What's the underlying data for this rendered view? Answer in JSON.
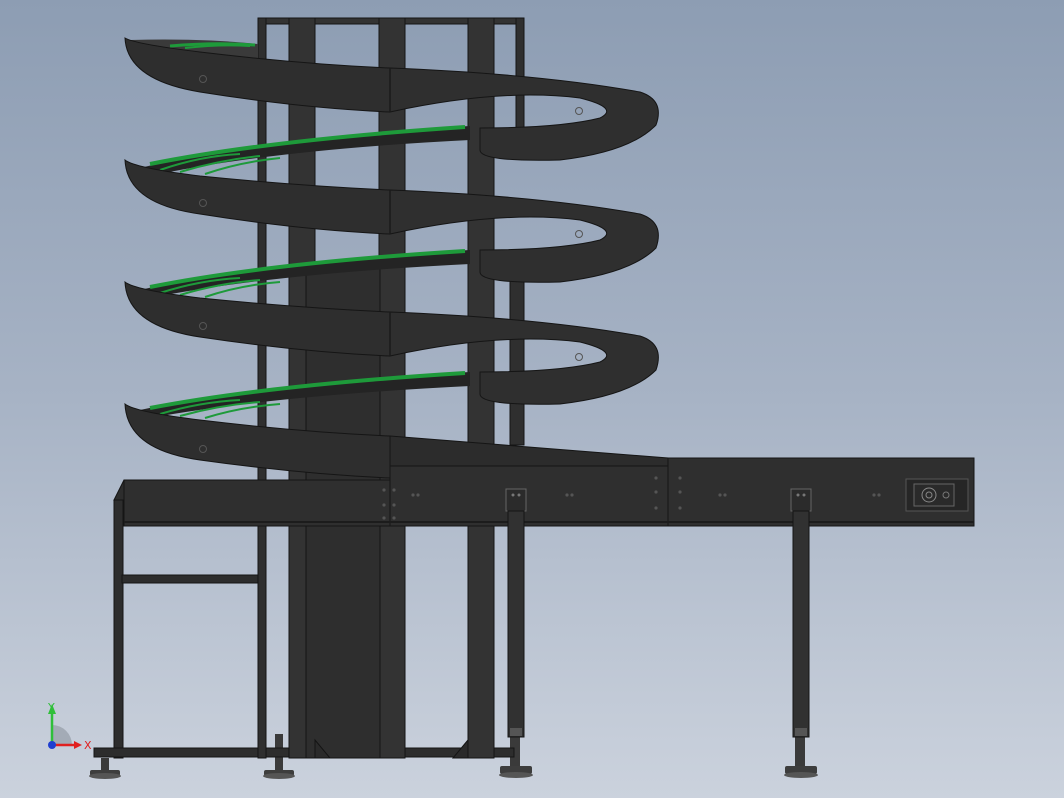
{
  "viewport": {
    "background_top": "#8d9db3",
    "background_bottom": "#cbd2dd"
  },
  "model": {
    "frame_color": "#2b2b2b",
    "belt_color": "#1e9a3a"
  },
  "triad": {
    "y_label": "Y",
    "x_label": "X",
    "y_color": "#2fbf3a",
    "x_color": "#e02020",
    "z_color": "#1f3fd0"
  }
}
